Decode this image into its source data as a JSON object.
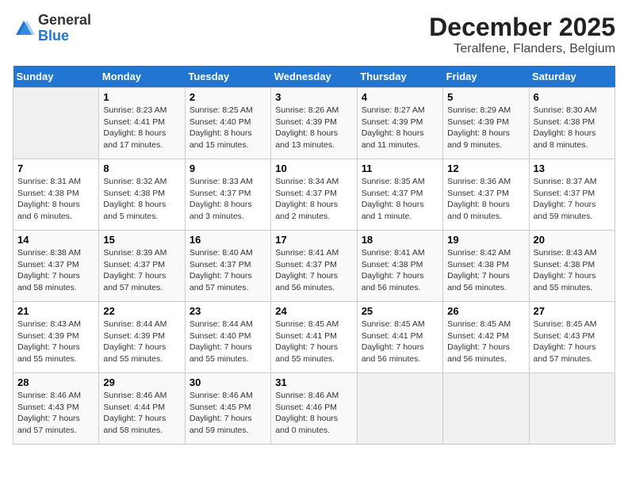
{
  "logo": {
    "general": "General",
    "blue": "Blue"
  },
  "title": "December 2025",
  "subtitle": "Teralfene, Flanders, Belgium",
  "headers": [
    "Sunday",
    "Monday",
    "Tuesday",
    "Wednesday",
    "Thursday",
    "Friday",
    "Saturday"
  ],
  "weeks": [
    [
      {
        "day": "",
        "info": ""
      },
      {
        "day": "1",
        "info": "Sunrise: 8:23 AM\nSunset: 4:41 PM\nDaylight: 8 hours\nand 17 minutes."
      },
      {
        "day": "2",
        "info": "Sunrise: 8:25 AM\nSunset: 4:40 PM\nDaylight: 8 hours\nand 15 minutes."
      },
      {
        "day": "3",
        "info": "Sunrise: 8:26 AM\nSunset: 4:39 PM\nDaylight: 8 hours\nand 13 minutes."
      },
      {
        "day": "4",
        "info": "Sunrise: 8:27 AM\nSunset: 4:39 PM\nDaylight: 8 hours\nand 11 minutes."
      },
      {
        "day": "5",
        "info": "Sunrise: 8:29 AM\nSunset: 4:39 PM\nDaylight: 8 hours\nand 9 minutes."
      },
      {
        "day": "6",
        "info": "Sunrise: 8:30 AM\nSunset: 4:38 PM\nDaylight: 8 hours\nand 8 minutes."
      }
    ],
    [
      {
        "day": "7",
        "info": "Sunrise: 8:31 AM\nSunset: 4:38 PM\nDaylight: 8 hours\nand 6 minutes."
      },
      {
        "day": "8",
        "info": "Sunrise: 8:32 AM\nSunset: 4:38 PM\nDaylight: 8 hours\nand 5 minutes."
      },
      {
        "day": "9",
        "info": "Sunrise: 8:33 AM\nSunset: 4:37 PM\nDaylight: 8 hours\nand 3 minutes."
      },
      {
        "day": "10",
        "info": "Sunrise: 8:34 AM\nSunset: 4:37 PM\nDaylight: 8 hours\nand 2 minutes."
      },
      {
        "day": "11",
        "info": "Sunrise: 8:35 AM\nSunset: 4:37 PM\nDaylight: 8 hours\nand 1 minute."
      },
      {
        "day": "12",
        "info": "Sunrise: 8:36 AM\nSunset: 4:37 PM\nDaylight: 8 hours\nand 0 minutes."
      },
      {
        "day": "13",
        "info": "Sunrise: 8:37 AM\nSunset: 4:37 PM\nDaylight: 7 hours\nand 59 minutes."
      }
    ],
    [
      {
        "day": "14",
        "info": "Sunrise: 8:38 AM\nSunset: 4:37 PM\nDaylight: 7 hours\nand 58 minutes."
      },
      {
        "day": "15",
        "info": "Sunrise: 8:39 AM\nSunset: 4:37 PM\nDaylight: 7 hours\nand 57 minutes."
      },
      {
        "day": "16",
        "info": "Sunrise: 8:40 AM\nSunset: 4:37 PM\nDaylight: 7 hours\nand 57 minutes."
      },
      {
        "day": "17",
        "info": "Sunrise: 8:41 AM\nSunset: 4:37 PM\nDaylight: 7 hours\nand 56 minutes."
      },
      {
        "day": "18",
        "info": "Sunrise: 8:41 AM\nSunset: 4:38 PM\nDaylight: 7 hours\nand 56 minutes."
      },
      {
        "day": "19",
        "info": "Sunrise: 8:42 AM\nSunset: 4:38 PM\nDaylight: 7 hours\nand 56 minutes."
      },
      {
        "day": "20",
        "info": "Sunrise: 8:43 AM\nSunset: 4:38 PM\nDaylight: 7 hours\nand 55 minutes."
      }
    ],
    [
      {
        "day": "21",
        "info": "Sunrise: 8:43 AM\nSunset: 4:39 PM\nDaylight: 7 hours\nand 55 minutes."
      },
      {
        "day": "22",
        "info": "Sunrise: 8:44 AM\nSunset: 4:39 PM\nDaylight: 7 hours\nand 55 minutes."
      },
      {
        "day": "23",
        "info": "Sunrise: 8:44 AM\nSunset: 4:40 PM\nDaylight: 7 hours\nand 55 minutes."
      },
      {
        "day": "24",
        "info": "Sunrise: 8:45 AM\nSunset: 4:41 PM\nDaylight: 7 hours\nand 55 minutes."
      },
      {
        "day": "25",
        "info": "Sunrise: 8:45 AM\nSunset: 4:41 PM\nDaylight: 7 hours\nand 56 minutes."
      },
      {
        "day": "26",
        "info": "Sunrise: 8:45 AM\nSunset: 4:42 PM\nDaylight: 7 hours\nand 56 minutes."
      },
      {
        "day": "27",
        "info": "Sunrise: 8:45 AM\nSunset: 4:43 PM\nDaylight: 7 hours\nand 57 minutes."
      }
    ],
    [
      {
        "day": "28",
        "info": "Sunrise: 8:46 AM\nSunset: 4:43 PM\nDaylight: 7 hours\nand 57 minutes."
      },
      {
        "day": "29",
        "info": "Sunrise: 8:46 AM\nSunset: 4:44 PM\nDaylight: 7 hours\nand 58 minutes."
      },
      {
        "day": "30",
        "info": "Sunrise: 8:46 AM\nSunset: 4:45 PM\nDaylight: 7 hours\nand 59 minutes."
      },
      {
        "day": "31",
        "info": "Sunrise: 8:46 AM\nSunset: 4:46 PM\nDaylight: 8 hours\nand 0 minutes."
      },
      {
        "day": "",
        "info": ""
      },
      {
        "day": "",
        "info": ""
      },
      {
        "day": "",
        "info": ""
      }
    ]
  ]
}
